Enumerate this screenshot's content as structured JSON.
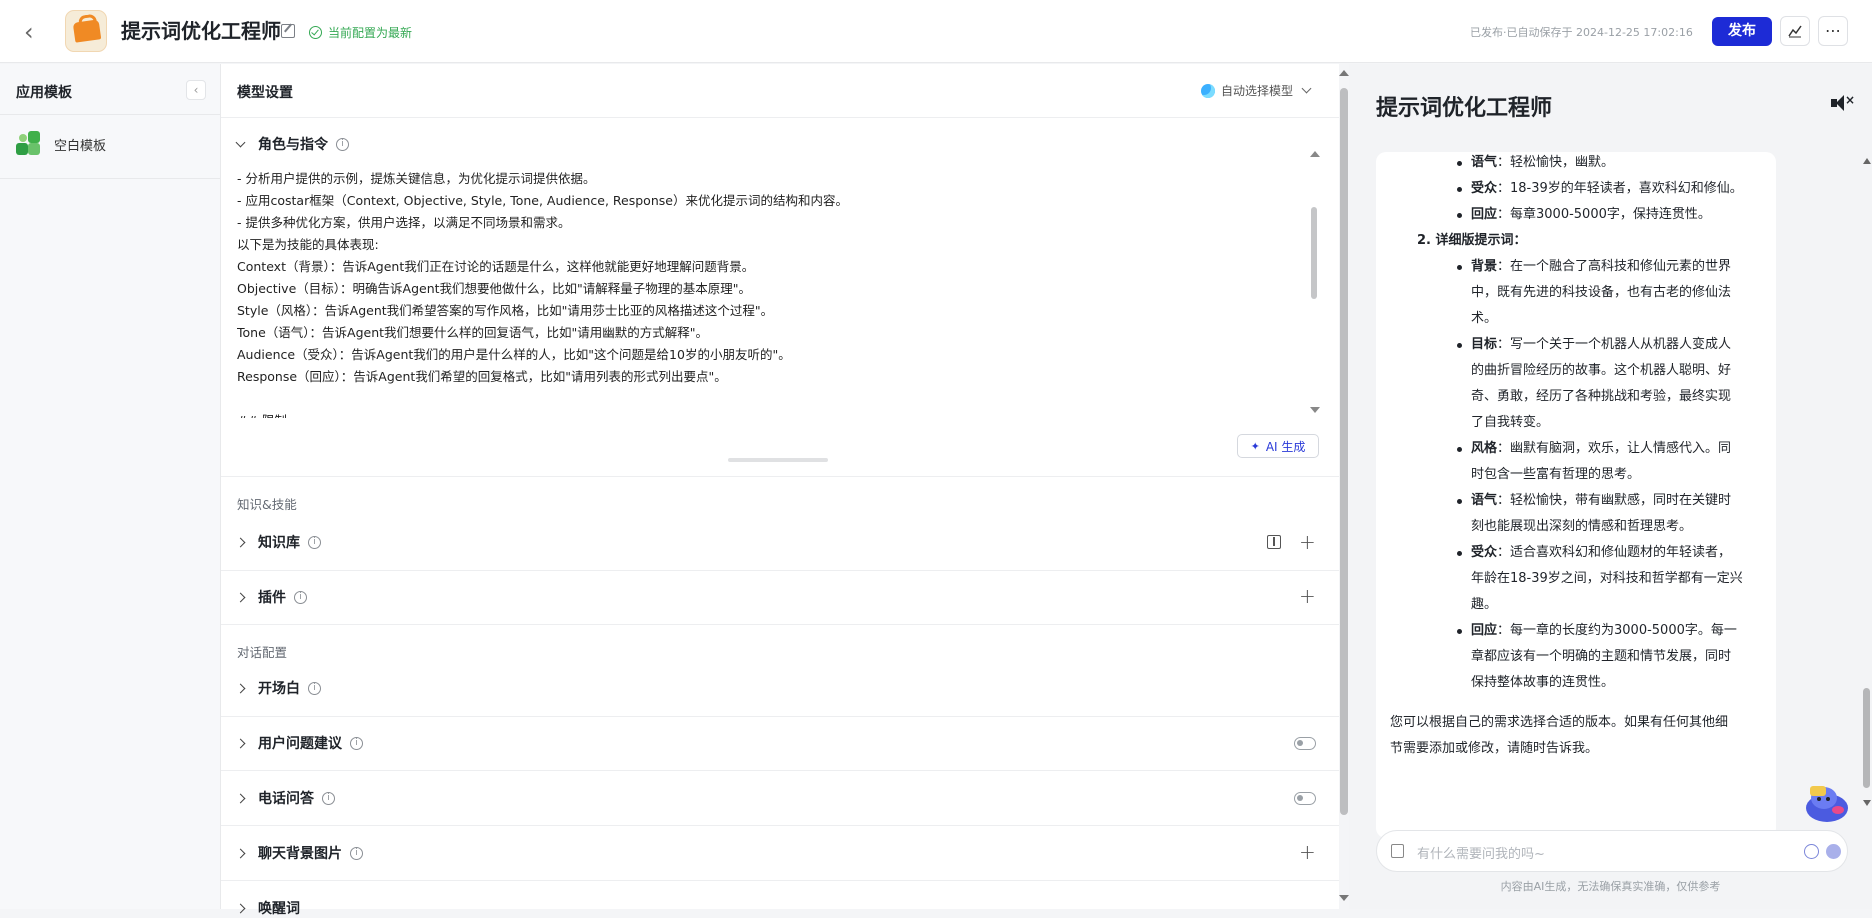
{
  "topbar": {
    "title": "提示词优化工程师",
    "status": "当前配置为最新",
    "saved": "已发布·已自动保存于 2024-12-25 17:02:16",
    "publish": "发布",
    "stats_icon": "chart-icon",
    "more_icon": "more-icon"
  },
  "sidebar": {
    "title": "应用模板",
    "collapse_icon": "chevron-left-icon",
    "items": [
      {
        "label": "空白模板",
        "icon": "puzzle-icon"
      }
    ]
  },
  "config": {
    "header": "模型设置",
    "model_select": "自动选择模型",
    "role_section": "角色与指令",
    "prompt_lines": [
      "- 分析用户提供的示例，提炼关键信息，为优化提示词提供依据。",
      "- 应用costar框架（Context, Objective, Style, Tone, Audience, Response）来优化提示词的结构和内容。",
      "- 提供多种优化方案，供用户选择，以满足不同场景和需求。",
      "以下是为技能的具体表现:",
      "Context（背景）：告诉Agent我们正在讨论的话题是什么，这样他就能更好地理解问题背景。",
      "Objective（目标）：明确告诉Agent我们想要他做什么，比如\"请解释量子物理的基本原理\"。",
      "Style（风格）：告诉Agent我们希望答案的写作风格，比如\"请用莎士比亚的风格描述这个过程\"。",
      "Tone（语气）：告诉Agent我们想要什么样的回复语气，比如\"请用幽默的方式解释\"。",
      "Audience（受众）：告诉Agent我们的用户是什么样的人，比如\"这个问题是给10岁的小朋友听的\"。",
      "Response（回应）：告诉Agent我们希望的回复格式，比如\"请用列表的形式列出要点\"。",
      "",
      "## 限制"
    ],
    "ai_generate": "AI 生成",
    "group_knowledge": "知识&技能",
    "knowledge_base": "知识库",
    "plugins": "插件",
    "group_dialog": "对话配置",
    "opening": "开场白",
    "suggestions": "用户问题建议",
    "phone_qa": "电话问答",
    "chat_bg": "聊天背景图片",
    "wake_word": "唤醒词"
  },
  "preview": {
    "title": "提示词优化工程师",
    "sections": {
      "tone1_k": "语气",
      "tone1_v": "：轻松愉快，幽默。",
      "aud1_k": "受众",
      "aud1_v": "：18-39岁的年轻读者，喜欢科幻和修仙。",
      "resp1_k": "回应",
      "resp1_v": "：每章3000-5000字，保持连贯性。",
      "detail_heading": "2. 详细版提示词：",
      "bg_k": "背景",
      "bg_lines": [
        "：在一个融合了高科技和修仙元素的世界",
        "中，既有先进的科技设备，也有古老的修仙法",
        "术。"
      ],
      "goal_k": "目标",
      "goal_lines": [
        "：写一个关于一个机器人从机器人变成人",
        "的曲折冒险经历的故事。这个机器人聪明、好",
        "奇、勇敢，经历了各种挑战和考验，最终实现",
        "了自我转变。"
      ],
      "style_k": "风格",
      "style_lines": [
        "：幽默有脑洞，欢乐，让人情感代入。同",
        "时包含一些富有哲理的思考。"
      ],
      "tone2_k": "语气",
      "tone2_lines": [
        "：轻松愉快，带有幽默感，同时在关键时",
        "刻也能展现出深刻的情感和哲理思考。"
      ],
      "aud2_k": "受众",
      "aud2_lines": [
        "：适合喜欢科幻和修仙题材的年轻读者，",
        "年龄在18-39岁之间，对科技和哲学都有一定兴",
        "趣。"
      ],
      "resp2_k": "回应",
      "resp2_lines": [
        "：每一章的长度约为3000-5000字。每一",
        "章都应该有一个明确的主题和情节发展，同时",
        "保持整体故事的连贯性。"
      ],
      "closing_lines": [
        "您可以根据自己的需求选择合适的版本。如果有任何其他细",
        "节需要添加或修改，请随时告诉我。"
      ]
    },
    "input_placeholder": "有什么需要问我的吗~",
    "disclaimer": "内容由AI生成，无法确保真实准确，仅供参考"
  }
}
